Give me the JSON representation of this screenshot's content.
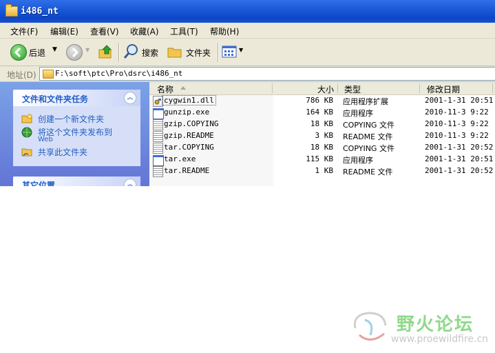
{
  "window": {
    "title": "i486_nt"
  },
  "menu": [
    "文件(F)",
    "编辑(E)",
    "查看(V)",
    "收藏(A)",
    "工具(T)",
    "帮助(H)"
  ],
  "toolbar": {
    "back_label": "后退",
    "search_label": "搜索",
    "folders_label": "文件夹"
  },
  "address": {
    "label": "地址(D)",
    "path": "F:\\soft\\ptc\\Pro\\dsrc\\i486_nt"
  },
  "tasks_panel": {
    "title": "文件和文件夹任务",
    "items": [
      {
        "label": "创建一个新文件夹",
        "label2": ""
      },
      {
        "label": "将这个文件夹发布到",
        "label2": "Web"
      },
      {
        "label": "共享此文件夹",
        "label2": ""
      }
    ]
  },
  "other_panel": {
    "title": "其它位置"
  },
  "columns": {
    "name": "名称",
    "size": "大小",
    "type": "类型",
    "modified": "修改日期"
  },
  "files": [
    {
      "name": "cygwin1.dll",
      "size": "786 KB",
      "type": "应用程序扩展",
      "date": "2001-1-31 20:51",
      "icon": "dll-icon"
    },
    {
      "name": "gunzip.exe",
      "size": "164 KB",
      "type": "应用程序",
      "date": "2010-11-3 9:22",
      "icon": "exe-icon"
    },
    {
      "name": "gzip.COPYING",
      "size": "18 KB",
      "type": "COPYING 文件",
      "date": "2010-11-3 9:22",
      "icon": "file-icon"
    },
    {
      "name": "gzip.README",
      "size": "3 KB",
      "type": "README 文件",
      "date": "2010-11-3 9:22",
      "icon": "file-icon"
    },
    {
      "name": "tar.COPYING",
      "size": "18 KB",
      "type": "COPYING 文件",
      "date": "2001-1-31 20:52",
      "icon": "file-icon"
    },
    {
      "name": "tar.exe",
      "size": "115 KB",
      "type": "应用程序",
      "date": "2001-1-31 20:51",
      "icon": "exe-icon"
    },
    {
      "name": "tar.README",
      "size": "1 KB",
      "type": "README 文件",
      "date": "2001-1-31 20:52",
      "icon": "file-icon"
    }
  ],
  "watermark": {
    "text": "野火论坛",
    "url": "www.proewildfire.cn"
  }
}
